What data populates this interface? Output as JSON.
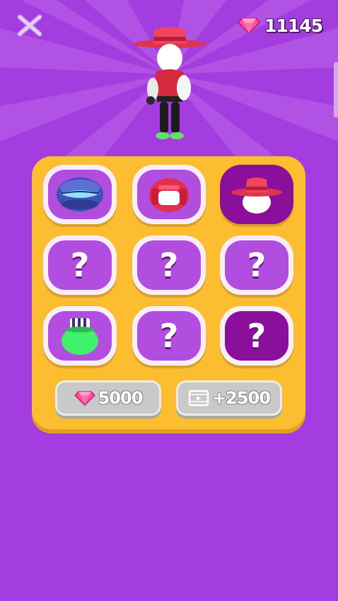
{
  "colors": {
    "background": "#a43ddf",
    "panel": "#fdbd30",
    "slot_locked": "#b14ee0",
    "slot_selected": "#8a0f9a",
    "gem": "#ff5ca8"
  },
  "header": {
    "close_icon": "close-x-icon",
    "gem_icon": "pink-gem-icon",
    "gem_balance": "11145"
  },
  "preview": {
    "character": "stickman-wearing-red-wide-brim-hat"
  },
  "slots": [
    {
      "state": "unlocked",
      "item": "blue-visor-helmet-icon",
      "label": ""
    },
    {
      "state": "unlocked",
      "item": "red-boxing-headgear-icon",
      "label": ""
    },
    {
      "state": "selected",
      "item": "red-wide-brim-hat-icon",
      "label": ""
    },
    {
      "state": "locked",
      "item": "question-mark-icon",
      "label": "?"
    },
    {
      "state": "locked",
      "item": "question-mark-icon",
      "label": "?"
    },
    {
      "state": "locked",
      "item": "question-mark-icon",
      "label": "?"
    },
    {
      "state": "unlocked",
      "item": "green-striped-cap-icon",
      "label": ""
    },
    {
      "state": "locked",
      "item": "question-mark-icon",
      "label": "?"
    },
    {
      "state": "locked-highlight",
      "item": "question-mark-icon",
      "label": "?"
    }
  ],
  "buttons": {
    "unlock_gem_icon": "pink-gem-icon",
    "unlock_cost": "5000",
    "video_icon": "video-play-icon",
    "video_reward": "+2500"
  }
}
